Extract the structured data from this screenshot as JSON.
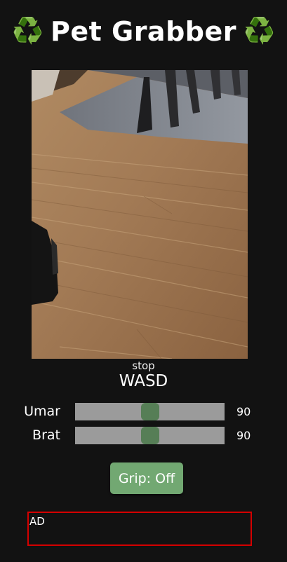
{
  "header": {
    "title": "Pet Grabber",
    "icon_left": "♻️",
    "icon_right": "♻️"
  },
  "camera": {
    "description_icon": "camera-feed"
  },
  "status": {
    "state": "stop",
    "controls": "WASD"
  },
  "sliders": [
    {
      "label": "Umar",
      "value": "90",
      "level": 0.5
    },
    {
      "label": "Brat",
      "value": "90",
      "level": 0.5
    }
  ],
  "grip": {
    "label": "Grip: Off"
  },
  "ad": {
    "text": "AD",
    "border_color": "#d40000"
  },
  "colors": {
    "background": "#121212",
    "button": "#72a872",
    "slider_track": "#9b9b9b",
    "slider_thumb": "#567e56"
  }
}
